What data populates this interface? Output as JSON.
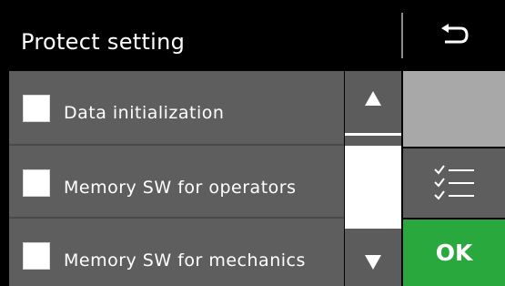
{
  "header": {
    "title": "Protect setting",
    "back_icon": "return-arrow-icon"
  },
  "list": {
    "items": [
      {
        "label": "Data initialization",
        "checked": false
      },
      {
        "label": "Memory SW for operators",
        "checked": false
      },
      {
        "label": "Memory SW for mechanics",
        "checked": false
      }
    ]
  },
  "scroll": {
    "up_icon": "triangle-up-icon",
    "down_icon": "triangle-down-icon"
  },
  "actions": {
    "select_all_icon": "checklist-icon",
    "ok_label": "OK"
  },
  "colors": {
    "background": "#000000",
    "row": "#5e5e5e",
    "disabled_panel": "#a8a8a8",
    "ok": "#29a83e"
  }
}
